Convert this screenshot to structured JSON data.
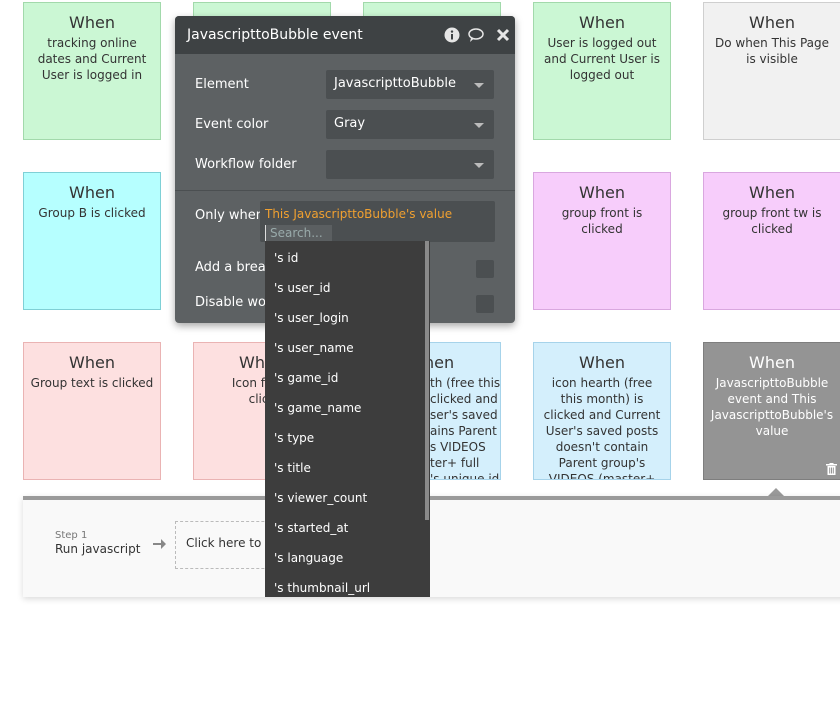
{
  "cards": [
    {
      "when": "When",
      "desc": "tracking online dates and Current User is logged in"
    },
    {
      "when": "",
      "desc": ""
    },
    {
      "when": "",
      "desc": ""
    },
    {
      "when": "When",
      "desc": "User is logged out and Current User is logged out"
    },
    {
      "when": "When",
      "desc": "Do when This Page is visible"
    },
    {
      "when": "When",
      "desc": "Group B is clicked"
    },
    {
      "when": "When",
      "desc": "group front is clicked"
    },
    {
      "when": "When",
      "desc": "group front tw is clicked"
    },
    {
      "when": "When",
      "desc": "Group text is clicked"
    },
    {
      "when": "When",
      "desc": "Icon fa fa-"
    },
    {
      "when": "hen",
      "desc": ""
    },
    {
      "when": "When",
      "desc": "icon hearth (free this month) is clicked and Current User's saved posts doesn't contain Parent group's VIDEOS (master+ full gameplay)'s unique id"
    },
    {
      "when": "When",
      "desc": "JavascripttoBubble event and This JavascripttoBubble's value"
    }
  ],
  "partial_card_text": "th (free this\nclicked and\nser's saved\nains Parent\ns VIDEOS\nter+ full\n's unique id",
  "partial_card_text2": "click",
  "icons": {
    "trash": "trash-icon",
    "arrow": "arrow-right-icon",
    "info": "info-icon",
    "comment": "comment-icon",
    "close": "close-icon"
  },
  "action": {
    "step_label": "Step 1",
    "step_name": "Run javascript",
    "box_text": "Click here to a"
  },
  "panel": {
    "title": "JavascripttoBubble event",
    "element_label": "Element",
    "element_value": "JavascripttoBubble",
    "color_label": "Event color",
    "color_value": "Gray",
    "folder_label": "Workflow folder",
    "folder_value": "",
    "only_when_label": "Only when",
    "condition": "This JavascripttoBubble's value",
    "search_placeholder": "Search...",
    "breakpoint_label": "Add a breakp",
    "disable_label": "Disable work"
  },
  "menu_items": [
    "'s id",
    "'s user_id",
    "'s user_login",
    "'s user_name",
    "'s game_id",
    "'s game_name",
    "'s type",
    "'s title",
    "'s viewer_count",
    "'s started_at",
    "'s language",
    "'s thumbnail_url"
  ],
  "colors": {
    "panel": "#5d6163",
    "header": "#3e4244",
    "condition": "#f0a030",
    "menu": "#3d3d3d",
    "selected_card": "#949494"
  }
}
